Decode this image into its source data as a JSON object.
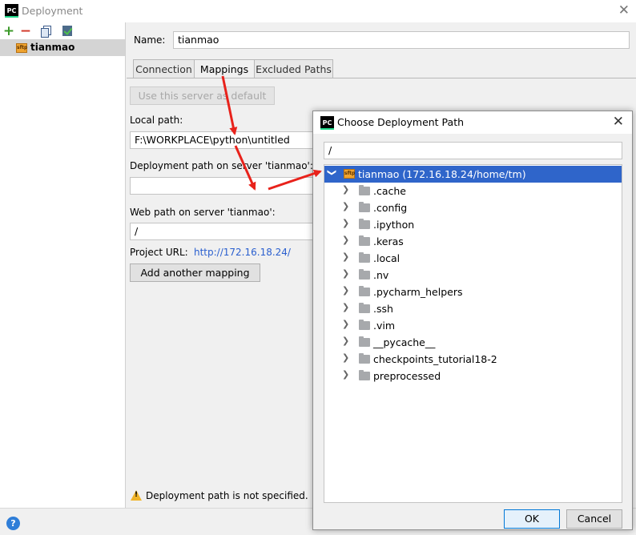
{
  "window": {
    "title": "Deployment",
    "app_icon": "PC",
    "close_glyph": "✕"
  },
  "toolbar": {
    "add_glyph": "+",
    "remove_glyph": "−"
  },
  "servers": [
    {
      "name": "tianmao",
      "icon": "sftp",
      "selected": true
    }
  ],
  "server_form": {
    "name_label": "Name:",
    "name_value": "tianmao",
    "tabs": [
      {
        "label": "Connection",
        "active": false
      },
      {
        "label": "Mappings",
        "active": true
      },
      {
        "label": "Excluded Paths",
        "active": false
      }
    ],
    "use_default_button": "Use this server as default",
    "local_path_label": "Local path:",
    "local_path_value": "F:\\WORKPLACE\\python\\untitled",
    "deployment_path_label": "Deployment path on server 'tianmao':",
    "deployment_path_value": "",
    "web_path_label": "Web path on server 'tianmao':",
    "web_path_value": "/",
    "project_url_label": "Project URL:",
    "project_url_value": "http://172.16.18.24/",
    "add_mapping_button": "Add another mapping",
    "warning_text": "Deployment path is not specified."
  },
  "help_icon": "?",
  "dialog": {
    "title": "Choose Deployment Path",
    "app_icon": "PC",
    "close_glyph": "✕",
    "path_value": "/",
    "root": {
      "label": "tianmao (172.16.18.24/home/tm)",
      "expanded": true,
      "selected": true,
      "icon": "sftp"
    },
    "folders": [
      ".cache",
      ".config",
      ".ipython",
      ".keras",
      ".local",
      ".nv",
      ".pycharm_helpers",
      ".ssh",
      ".vim",
      "__pycache__",
      "checkpoints_tutorial18-2",
      "preprocessed"
    ],
    "ok_button": "OK",
    "cancel_button": "Cancel"
  },
  "colors": {
    "selection_blue": "#2f65ca",
    "annotation_red": "#e8221b",
    "link_blue": "#2a5fcf",
    "warning_yellow": "#f0b429"
  }
}
